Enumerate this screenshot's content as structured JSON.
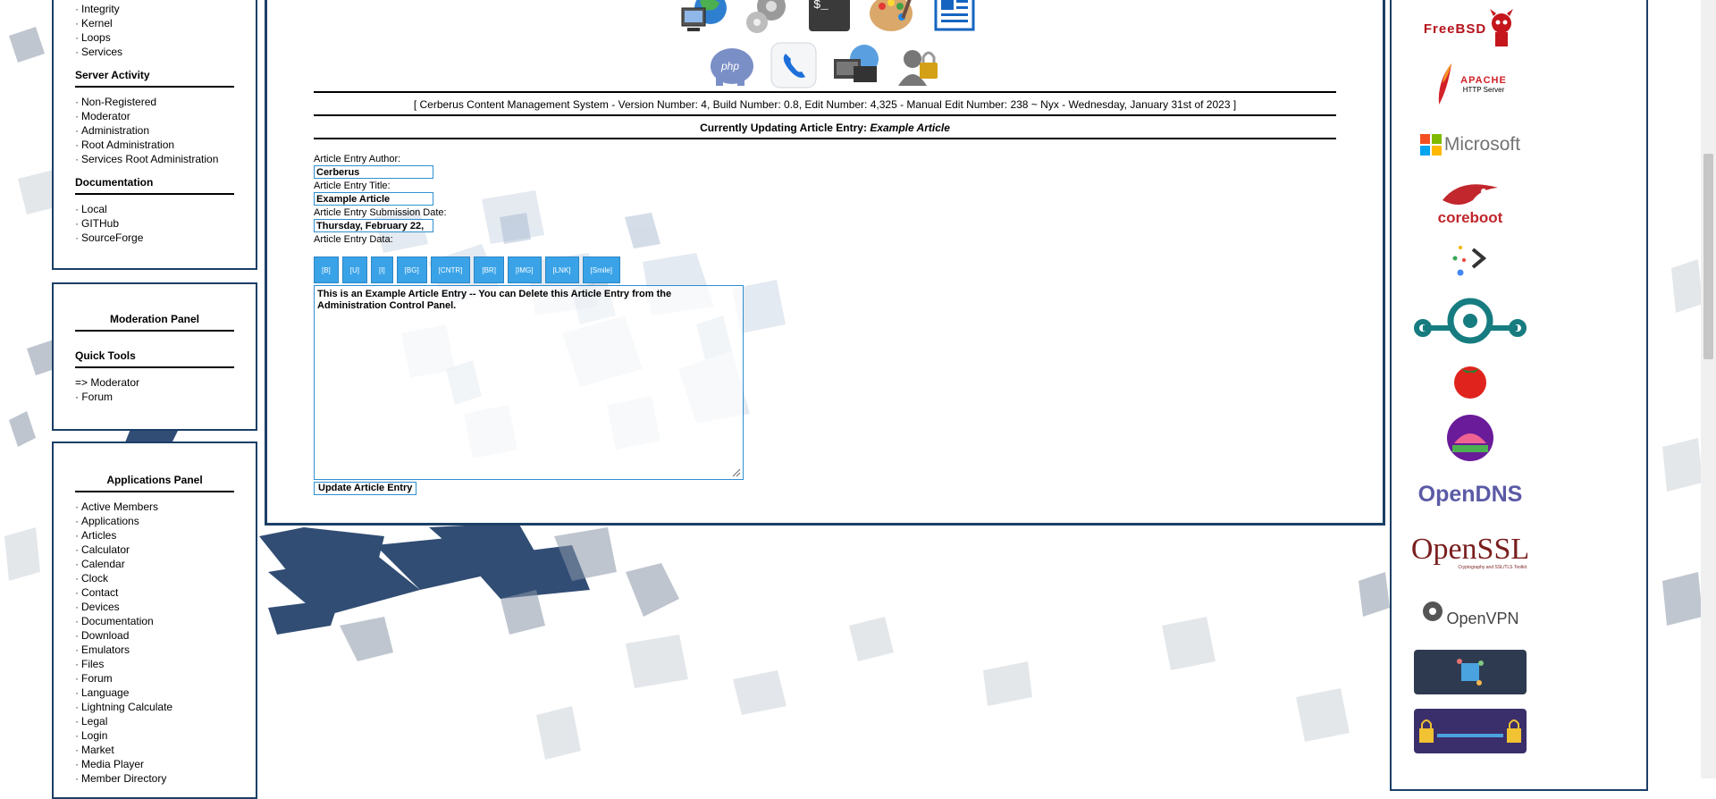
{
  "admin_panel": {
    "top_items": [
      "Integrity",
      "Kernel",
      "Loops",
      "Services"
    ],
    "server_activity_title": "Server Activity",
    "server_activity_items": [
      "Non-Registered",
      "Moderator",
      "Administration",
      "Root Administration",
      "Services Root Administration"
    ],
    "documentation_title": "Documentation",
    "documentation_items": [
      "Local",
      "GITHub",
      "SourceForge"
    ]
  },
  "moderation_panel": {
    "title": "Moderation Panel",
    "quick_tools_title": "Quick Tools",
    "quick_tools_items": [
      "=> Moderator",
      "· Forum"
    ]
  },
  "applications_panel": {
    "title": "Applications Panel",
    "items": [
      "Active Members",
      "Applications",
      "Articles",
      "Calculator",
      "Calendar",
      "Clock",
      "Contact",
      "Devices",
      "Documentation",
      "Download",
      "Emulators",
      "Files",
      "Forum",
      "Language",
      "Lightning Calculate",
      "Legal",
      "Login",
      "Market",
      "Media Player",
      "Member Directory"
    ]
  },
  "content": {
    "version_line": "[ Cerberus Content Management System - Version Number: 4, Build Number: 0.8, Edit Number: 4,325 - Manual Edit Number: 238 ~ Nyx - Wednesday, January 31st of 2023 ]",
    "updating_prefix": "Currently Updating Article Entry: ",
    "updating_title": "Example Article",
    "author_label": "Article Entry Author:",
    "author_value": "Cerberus",
    "title_label": "Article Entry Title:",
    "title_value": "Example Article",
    "date_label": "Article Entry Submission Date:",
    "date_value": "Thursday, February 22,",
    "data_label": "Article Entry Data:",
    "toolbar": [
      "[B]",
      "[U]",
      "[I]",
      "[BG]",
      "[CNTR]",
      "[BR]",
      "[IMG]",
      "[LNK]",
      "[Smile]"
    ],
    "editor_text": "This is an Example Article Entry -- You can Delete this Article Entry from the Administration Control Panel.",
    "submit_label": "Update Article Entry"
  },
  "sponsors": {
    "freebsd": "FreeBSD",
    "apache_top": "APACHE",
    "apache_bottom": "HTTP Server",
    "microsoft": "Microsoft",
    "coreboot": "coreboot",
    "opendns": "OpenDNS",
    "openssl": "OpenSSL",
    "openssl_sub": "Cryptography and SSL/TLS Toolkit",
    "openvpn": "OpenVPN"
  },
  "colors": {
    "panel_border": "#1b3f66",
    "button_blue": "#3aa3e8",
    "field_border": "#2f8fd2"
  },
  "icons": [
    "computer-globe-icon",
    "gears-icon",
    "terminal-icon",
    "palette-icon",
    "newspaper-icon",
    "php-elephant-icon",
    "phone-icon",
    "network-globe-icon",
    "user-lock-icon"
  ]
}
